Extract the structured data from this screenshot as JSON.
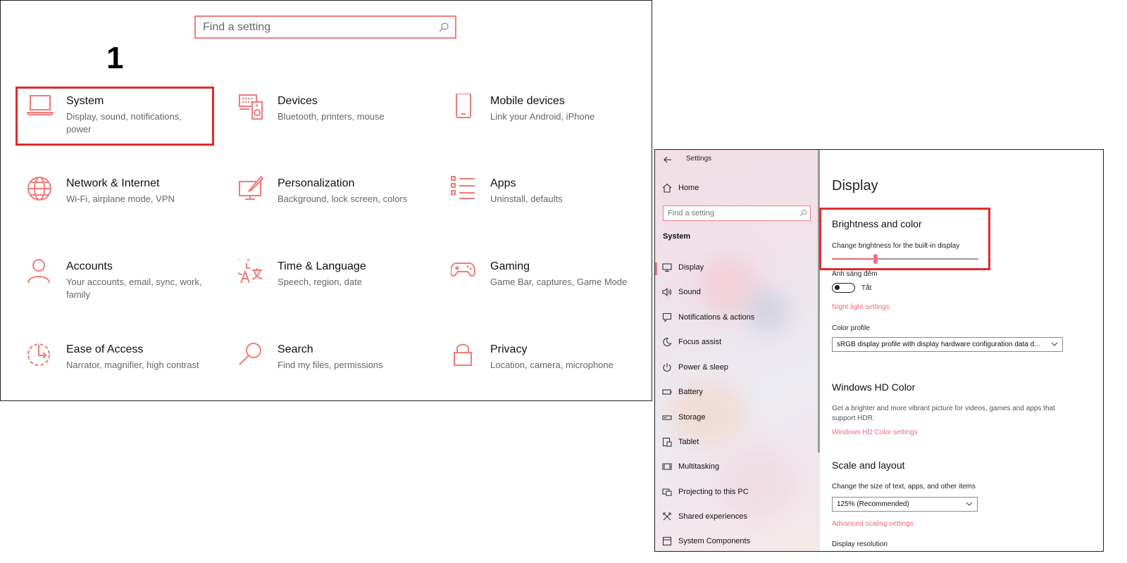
{
  "home": {
    "search_placeholder": "Find a setting",
    "step_label": "1",
    "tiles": [
      {
        "title": "System",
        "subtitle": "Display, sound, notifications, power",
        "icon": "laptop-icon"
      },
      {
        "title": "Devices",
        "subtitle": "Bluetooth, printers, mouse",
        "icon": "keyboard-speaker-icon"
      },
      {
        "title": "Mobile devices",
        "subtitle": "Link your Android, iPhone",
        "icon": "phone-icon"
      },
      {
        "title": "Network & Internet",
        "subtitle": "Wi-Fi, airplane mode, VPN",
        "icon": "globe-icon"
      },
      {
        "title": "Personalization",
        "subtitle": "Background, lock screen, colors",
        "icon": "paint-monitor-icon"
      },
      {
        "title": "Apps",
        "subtitle": "Uninstall, defaults",
        "icon": "app-list-icon"
      },
      {
        "title": "Accounts",
        "subtitle": "Your accounts, email, sync, work, family",
        "icon": "person-icon"
      },
      {
        "title": "Time & Language",
        "subtitle": "Speech, region, date",
        "icon": "clock-language-icon"
      },
      {
        "title": "Gaming",
        "subtitle": "Game Bar, captures, Game Mode",
        "icon": "gamepad-icon"
      },
      {
        "title": "Ease of Access",
        "subtitle": "Narrator, magnifier, high contrast",
        "icon": "ease-of-access-icon"
      },
      {
        "title": "Search",
        "subtitle": "Find my files, permissions",
        "icon": "magnifier-icon"
      },
      {
        "title": "Privacy",
        "subtitle": "Location, camera, microphone",
        "icon": "padlock-icon"
      }
    ]
  },
  "settings_window": {
    "title": "Settings",
    "home_label": "Home",
    "search_placeholder": "Find a setting",
    "section_label": "System",
    "nav_items": [
      {
        "label": "Display",
        "icon": "monitor-icon",
        "selected": true
      },
      {
        "label": "Sound",
        "icon": "speaker-icon"
      },
      {
        "label": "Notifications & actions",
        "icon": "notification-icon"
      },
      {
        "label": "Focus assist",
        "icon": "moon-icon"
      },
      {
        "label": "Power & sleep",
        "icon": "power-icon"
      },
      {
        "label": "Battery",
        "icon": "battery-icon"
      },
      {
        "label": "Storage",
        "icon": "storage-icon"
      },
      {
        "label": "Tablet",
        "icon": "tablet-icon"
      },
      {
        "label": "Multitasking",
        "icon": "multitasking-icon"
      },
      {
        "label": "Projecting to this PC",
        "icon": "projecting-icon"
      },
      {
        "label": "Shared experiences",
        "icon": "shared-experiences-icon"
      },
      {
        "label": "System Components",
        "icon": "components-icon"
      }
    ],
    "page_title": "Display",
    "brightness": {
      "heading": "Brightness and color",
      "label": "Change brightness for the built-in display",
      "level_fraction": 0.3
    },
    "night_light": {
      "label": "Ánh sáng đêm",
      "toggle_state": "Tắt",
      "settings_link": "Night light settings"
    },
    "color_profile": {
      "label": "Color profile",
      "value": "sRGB display profile with display hardware configuration data d..."
    },
    "hd_color": {
      "heading": "Windows HD Color",
      "description": "Get a brighter and more vibrant picture for videos, games and apps that support HDR.",
      "link": "Windows HD Color settings"
    },
    "scale": {
      "heading": "Scale and layout",
      "label": "Change the size of text, apps, and other items",
      "value": "125% (Recommended)",
      "link": "Advanced scaling settings",
      "resolution_label": "Display resolution"
    }
  },
  "colors": {
    "accent_icon": "#f07a7a",
    "highlight_box": "#e32b2b",
    "link": "#ee6a78"
  }
}
